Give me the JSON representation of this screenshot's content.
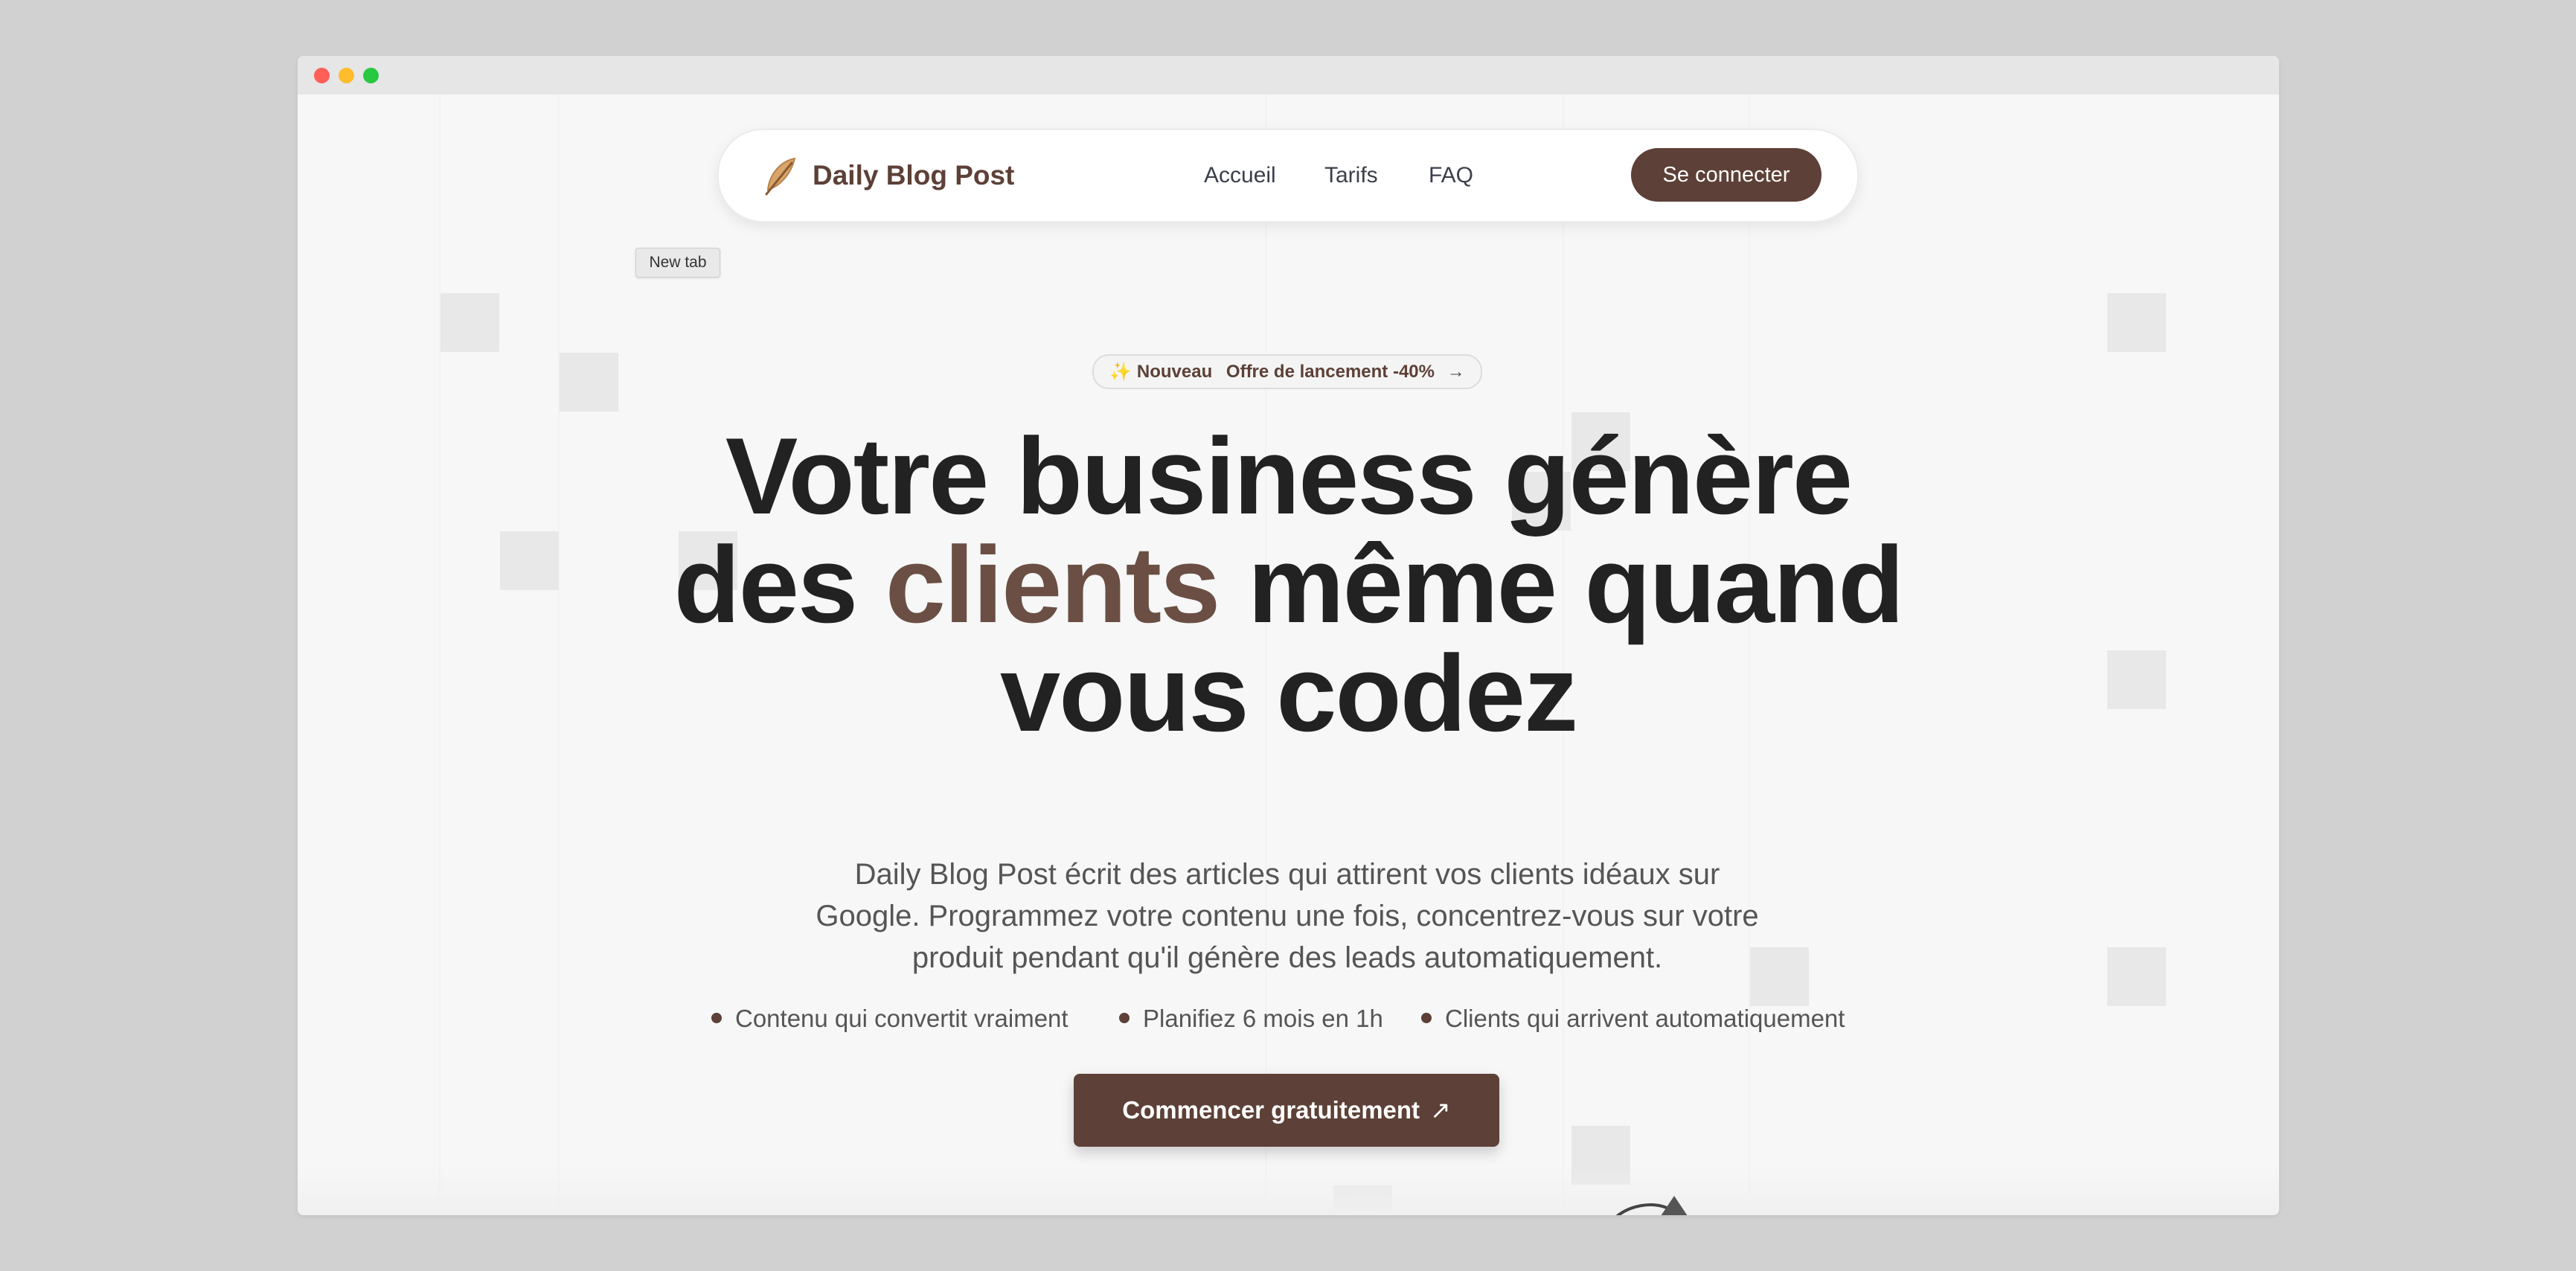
{
  "window": {
    "controls": [
      "close",
      "minimize",
      "maximize"
    ]
  },
  "tooltip": {
    "text": "New tab"
  },
  "nav": {
    "brand": "Daily Blog Post",
    "logo_icon": "feather-icon",
    "links": [
      "Accueil",
      "Tarifs",
      "FAQ"
    ],
    "login_label": "Se connecter"
  },
  "badge": {
    "icon": "✨",
    "label": "Nouveau",
    "text": "Offre de lancement -40%",
    "arrow": "→"
  },
  "hero": {
    "line1": "Votre business génère",
    "line2_start": "des",
    "line2_accent": "clients",
    "line2_end": "même quand",
    "line3": "vous codez"
  },
  "subtitle": "Daily Blog Post écrit des articles qui attirent vos clients idéaux sur Google. Programmez votre contenu une fois, concentrez-vous sur votre produit pendant qu'il génère des leads automatiquement.",
  "features": [
    "Contenu qui convertit vraiment",
    "Planifiez 6 mois en 1h",
    "Clients qui arrivent automatiquement"
  ],
  "cta": {
    "label": "Commencer gratuitement",
    "icon": "↗"
  },
  "colors": {
    "brand": "#5d4037",
    "accent_text": "#6b4f44",
    "heading": "#222222",
    "body_text": "#555555",
    "background": "#f7f7f7"
  }
}
